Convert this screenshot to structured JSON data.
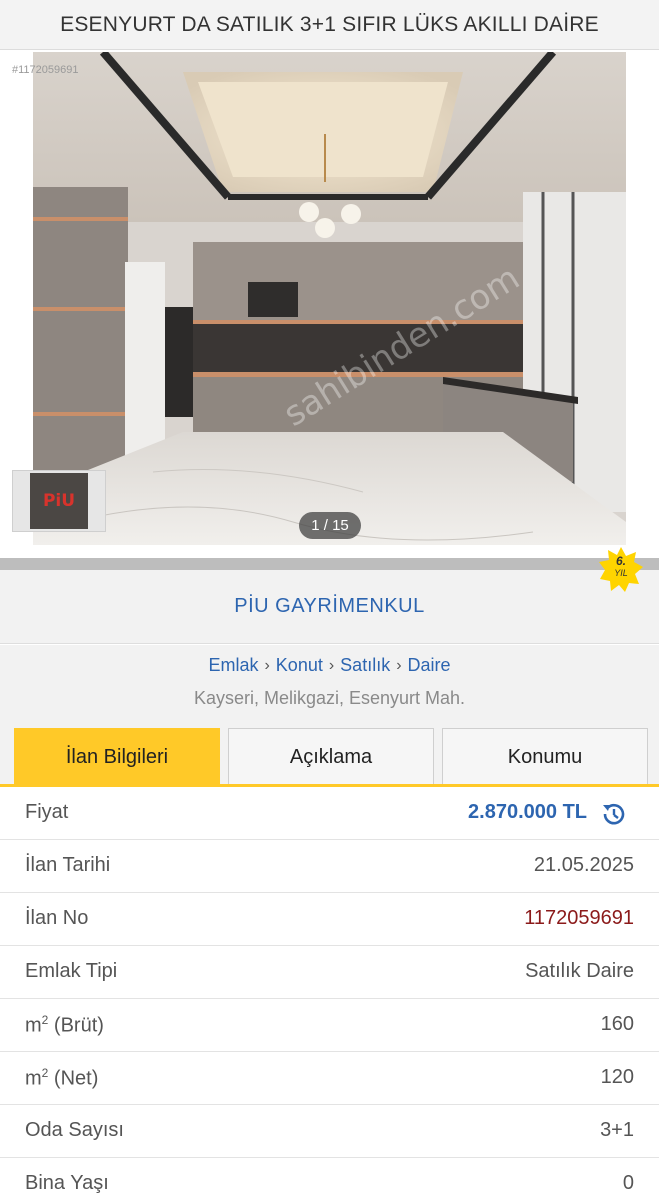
{
  "header": {
    "title": "ESENYURT DA SATILIK 3+1 SIFIR LÜKS AKILLI DAİRE"
  },
  "gallery": {
    "listing_tag": "#1172059691",
    "counter": "1 / 15",
    "watermark": "sahibinden.com",
    "logo_text": "PiU"
  },
  "store": {
    "name": "PİU GAYRİMENKUL",
    "badge_number": "6.",
    "badge_label": "YIL",
    "badge_color": "#ffd400"
  },
  "breadcrumb": {
    "items": [
      "Emlak",
      "Konut",
      "Satılık",
      "Daire"
    ],
    "separator": "›"
  },
  "location": "Kayseri, Melikgazi, Esenyurt Mah.",
  "tabs": [
    {
      "label": "İlan Bilgileri",
      "active": true
    },
    {
      "label": "Açıklama",
      "active": false
    },
    {
      "label": "Konumu",
      "active": false
    }
  ],
  "info_rows": [
    {
      "label": "Fiyat",
      "value": "2.870.000 TL",
      "icon": "price-history-icon"
    },
    {
      "label": "İlan Tarihi",
      "value": "21.05.2025"
    },
    {
      "label": "İlan No",
      "value": "1172059691"
    },
    {
      "label": "Emlak Tipi",
      "value": "Satılık Daire"
    },
    {
      "label_prefix": "m",
      "label_sup": "2",
      "label_suffix": " (Brüt)",
      "value": "160"
    },
    {
      "label_prefix": "m",
      "label_sup": "2",
      "label_suffix": " (Net)",
      "value": "120"
    },
    {
      "label": "Oda Sayısı",
      "value": "3+1"
    },
    {
      "label": "Bina Yaşı",
      "value": "0"
    }
  ],
  "colors": {
    "accent_yellow": "#ffc928",
    "link_blue": "#2d65b0",
    "listing_no_red": "#8b1a1a"
  }
}
